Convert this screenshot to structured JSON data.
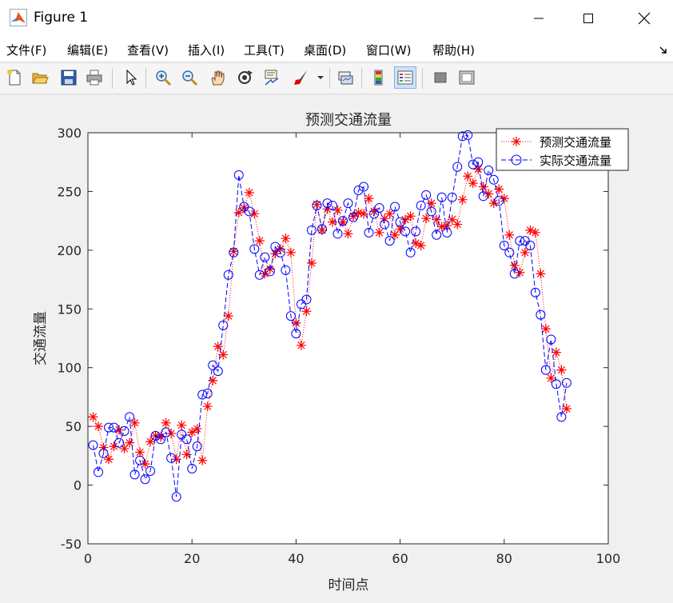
{
  "window": {
    "title": "Figure 1",
    "controls": [
      "minimize",
      "maximize",
      "close"
    ]
  },
  "menu": [
    "文件(F)",
    "编辑(E)",
    "查看(V)",
    "插入(I)",
    "工具(T)",
    "桌面(D)",
    "窗口(W)",
    "帮助(H)"
  ],
  "toolbar": [
    "new-figure-icon",
    "open-file-icon",
    "save-icon",
    "print-icon",
    "pointer-icon",
    "zoom-in-icon",
    "zoom-out-icon",
    "pan-hand-icon",
    "rotate-3d-icon",
    "data-cursor-icon",
    "brush-icon",
    "brush-dropdown-icon",
    "link-plot-icon",
    "insert-colorbar-icon",
    "insert-legend-icon",
    "hide-plot-tools-icon",
    "show-plot-tools-icon"
  ],
  "chart_data": {
    "type": "line",
    "title": "预测交通流量",
    "xlabel": "时间点",
    "ylabel": "交通流量",
    "xlim": [
      0,
      100
    ],
    "ylim": [
      -50,
      300
    ],
    "xticks": [
      0,
      20,
      40,
      60,
      80,
      100
    ],
    "yticks": [
      -50,
      0,
      50,
      100,
      150,
      200,
      250,
      300
    ],
    "legend_position": "top-right",
    "grid": false,
    "x": [
      1,
      2,
      3,
      4,
      5,
      6,
      7,
      8,
      9,
      10,
      11,
      12,
      13,
      14,
      15,
      16,
      17,
      18,
      19,
      20,
      21,
      22,
      23,
      24,
      25,
      26,
      27,
      28,
      29,
      30,
      31,
      32,
      33,
      34,
      35,
      36,
      37,
      38,
      39,
      40,
      41,
      42,
      43,
      44,
      45,
      46,
      47,
      48,
      49,
      50,
      51,
      52,
      53,
      54,
      55,
      56,
      57,
      58,
      59,
      60,
      61,
      62,
      63,
      64,
      65,
      66,
      67,
      68,
      69,
      70,
      71,
      72,
      73,
      74,
      75,
      76,
      77,
      78,
      79,
      80,
      81,
      82,
      83,
      84,
      85,
      86,
      87,
      88,
      89,
      90,
      91,
      92
    ],
    "series": [
      {
        "name": "预测交通流量",
        "color": "#ff0000",
        "line": "dotted",
        "marker": "asterisk",
        "values": [
          58,
          50,
          32,
          22,
          33,
          47,
          31,
          36,
          53,
          28,
          18,
          37,
          42,
          41,
          53,
          44,
          22,
          51,
          26,
          45,
          48,
          21,
          67,
          89,
          118,
          111,
          144,
          199,
          232,
          236,
          249,
          231,
          208,
          180,
          184,
          197,
          201,
          210,
          198,
          138,
          119,
          148,
          189,
          239,
          217,
          235,
          224,
          234,
          224,
          214,
          229,
          232,
          231,
          244,
          233,
          215,
          227,
          231,
          213,
          218,
          226,
          229,
          206,
          204,
          227,
          240,
          226,
          220,
          221,
          226,
          222,
          243,
          263,
          257,
          269,
          254,
          248,
          240,
          252,
          244,
          213,
          187,
          181,
          198,
          217,
          215,
          180,
          133,
          91,
          113,
          98,
          65
        ]
      },
      {
        "name": "实际交通流量",
        "color": "#0000ff",
        "line": "dashed",
        "marker": "circle",
        "values": [
          34,
          11,
          27,
          49,
          49,
          36,
          46,
          58,
          9,
          21,
          5,
          12,
          42,
          39,
          45,
          23,
          -10,
          43,
          39,
          14,
          33,
          77,
          78,
          102,
          97,
          136,
          179,
          198,
          264,
          237,
          233,
          201,
          179,
          194,
          182,
          203,
          198,
          183,
          144,
          129,
          154,
          158,
          217,
          238,
          218,
          240,
          238,
          214,
          225,
          240,
          228,
          251,
          254,
          215,
          231,
          236,
          222,
          208,
          237,
          224,
          216,
          198,
          216,
          238,
          247,
          233,
          213,
          245,
          215,
          245,
          271,
          297,
          298,
          273,
          275,
          246,
          268,
          260,
          242,
          204,
          198,
          180,
          208,
          208,
          204,
          164,
          145,
          98,
          124,
          86,
          58,
          87
        ]
      }
    ]
  }
}
